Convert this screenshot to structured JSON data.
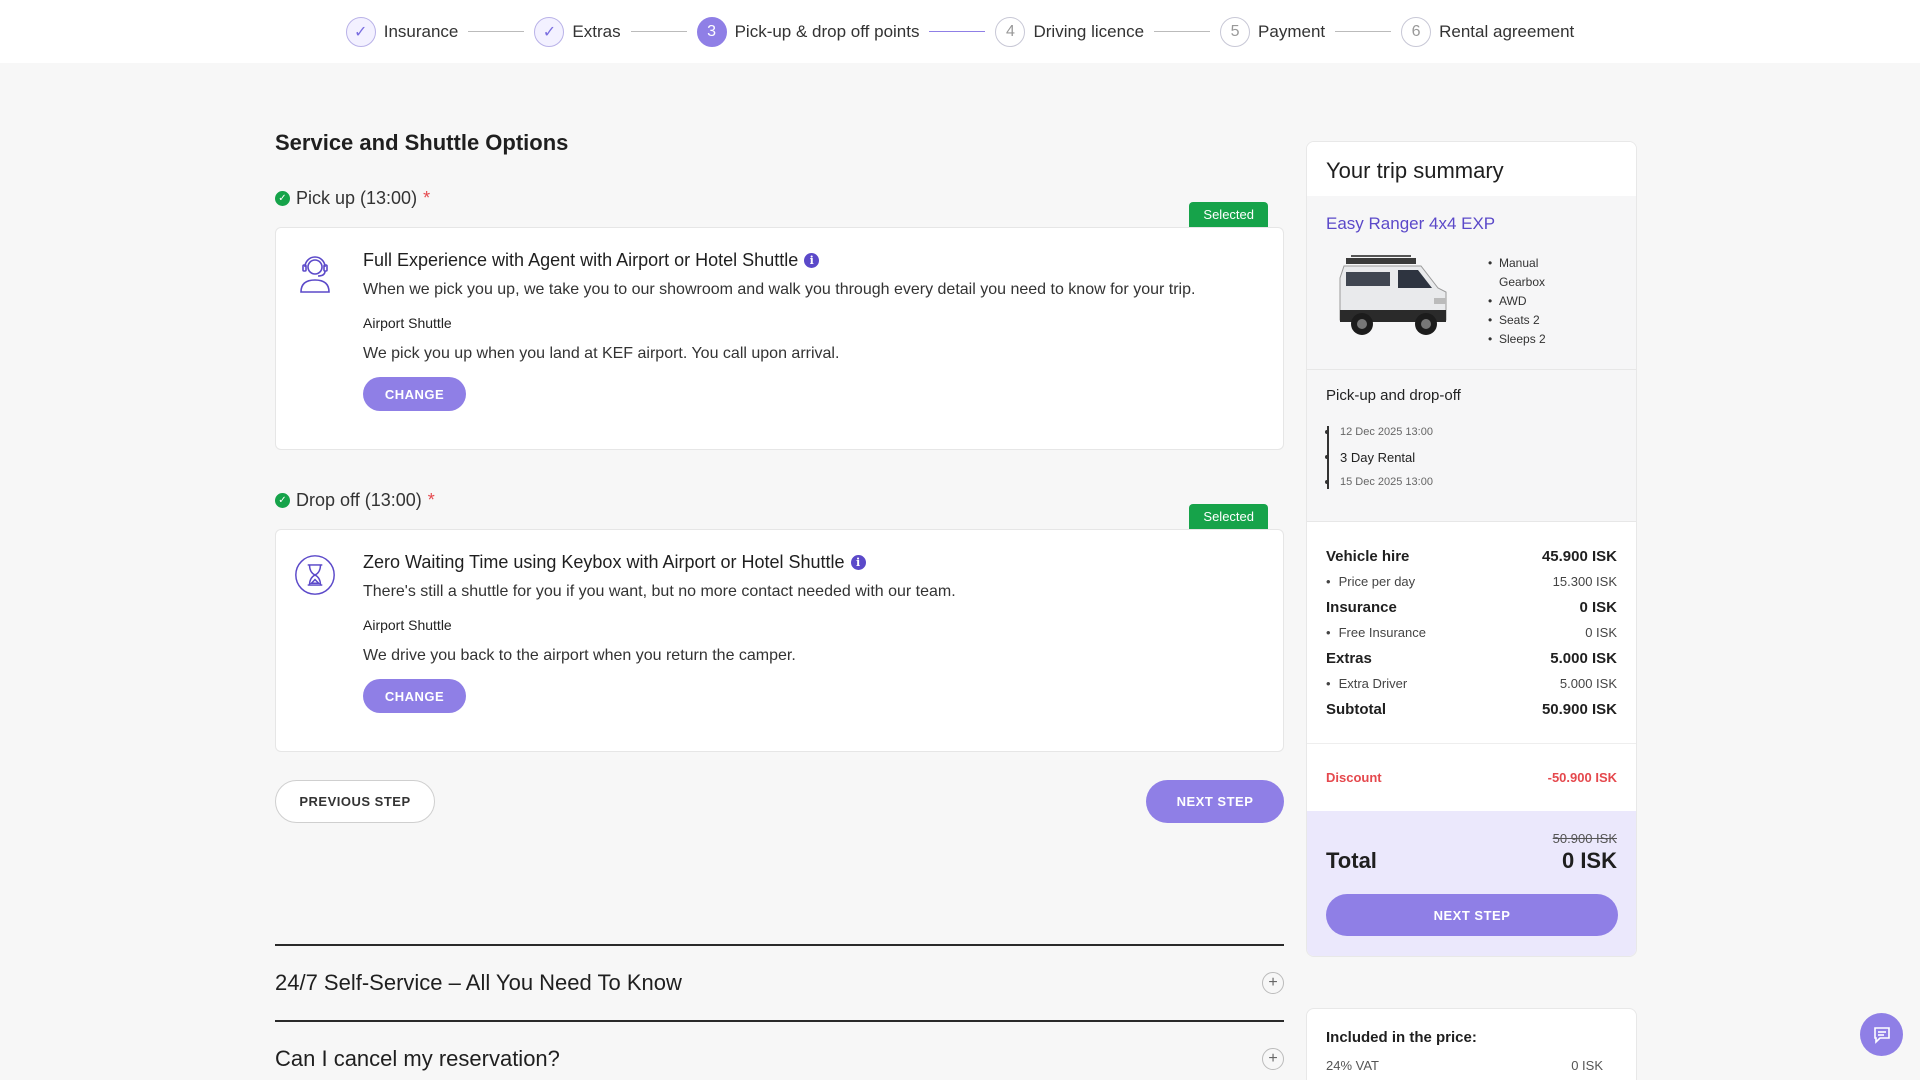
{
  "stepper": {
    "steps": [
      {
        "num": "✓",
        "label": "Insurance"
      },
      {
        "num": "✓",
        "label": "Extras"
      },
      {
        "num": "3",
        "label": "Pick-up & drop off points"
      },
      {
        "num": "4",
        "label": "Driving licence"
      },
      {
        "num": "5",
        "label": "Payment"
      },
      {
        "num": "6",
        "label": "Rental agreement"
      }
    ]
  },
  "main": {
    "title": "Service and Shuttle Options",
    "pickup": {
      "label": "Pick up (13:00)",
      "required": "*",
      "badge": "Selected",
      "icon": "agent-headset-icon",
      "heading": "Full Experience with Agent with Airport or Hotel Shuttle",
      "info": "i",
      "description": "When we pick you up, we take you to our showroom and walk you through every detail you need to know for your trip.",
      "sub_label": "Airport Shuttle",
      "note": "We pick you up when you land at KEF airport. You call upon arrival.",
      "button": "CHANGE"
    },
    "dropoff": {
      "label": "Drop off (13:00)",
      "required": "*",
      "badge": "Selected",
      "icon": "hourglass-icon",
      "heading": "Zero Waiting Time using Keybox with Airport or Hotel Shuttle",
      "info": "i",
      "description": "There's still a shuttle for you if you want, but no more contact needed with our team.",
      "sub_label": "Airport Shuttle",
      "note": "We drive you back to the airport when you return the camper.",
      "button": "CHANGE"
    },
    "prev_button": "PREVIOUS STEP",
    "next_button": "NEXT STEP",
    "faq": [
      {
        "question": "24/7 Self-Service – All You Need To Know",
        "icon": "plus-icon"
      },
      {
        "question": "Can I cancel my reservation?",
        "icon": "plus-icon"
      }
    ]
  },
  "summary": {
    "title": "Your trip summary",
    "vehicle": {
      "name": "Easy Ranger 4x4 EXP",
      "specs": [
        "Manual Gearbox",
        "AWD",
        "Seats 2",
        "Sleeps 2"
      ]
    },
    "pickup_dropoff": {
      "title": "Pick-up and drop-off",
      "start": "12 Dec 2025 13:00",
      "duration": "3 Day Rental",
      "end": "15 Dec 2025 13:00"
    },
    "costs": {
      "vehicle_hire": {
        "label": "Vehicle hire",
        "value": "45.900 ISK"
      },
      "price_per_day": {
        "label": "Price per day",
        "value": "15.300 ISK"
      },
      "insurance": {
        "label": "Insurance",
        "value": "0 ISK"
      },
      "free_insurance": {
        "label": "Free Insurance",
        "value": "0 ISK"
      },
      "extras": {
        "label": "Extras",
        "value": "5.000 ISK"
      },
      "extra_driver": {
        "label": "Extra Driver",
        "value": "5.000 ISK"
      },
      "subtotal": {
        "label": "Subtotal",
        "value": "50.900 ISK"
      }
    },
    "discount": {
      "label": "Discount",
      "value": "-50.900 ISK"
    },
    "original_total": "50.900 ISK",
    "total": {
      "label": "Total",
      "value": "0 ISK"
    },
    "button": "NEXT STEP"
  },
  "included": {
    "title": "Included in the price:",
    "items": [
      {
        "label": "24% VAT",
        "value": "0 ISK"
      }
    ]
  },
  "colors": {
    "accent": "#8f7fe6",
    "brand_text": "#5b49c9",
    "selected_green": "#16a34a",
    "discount_red": "#e5484d"
  }
}
